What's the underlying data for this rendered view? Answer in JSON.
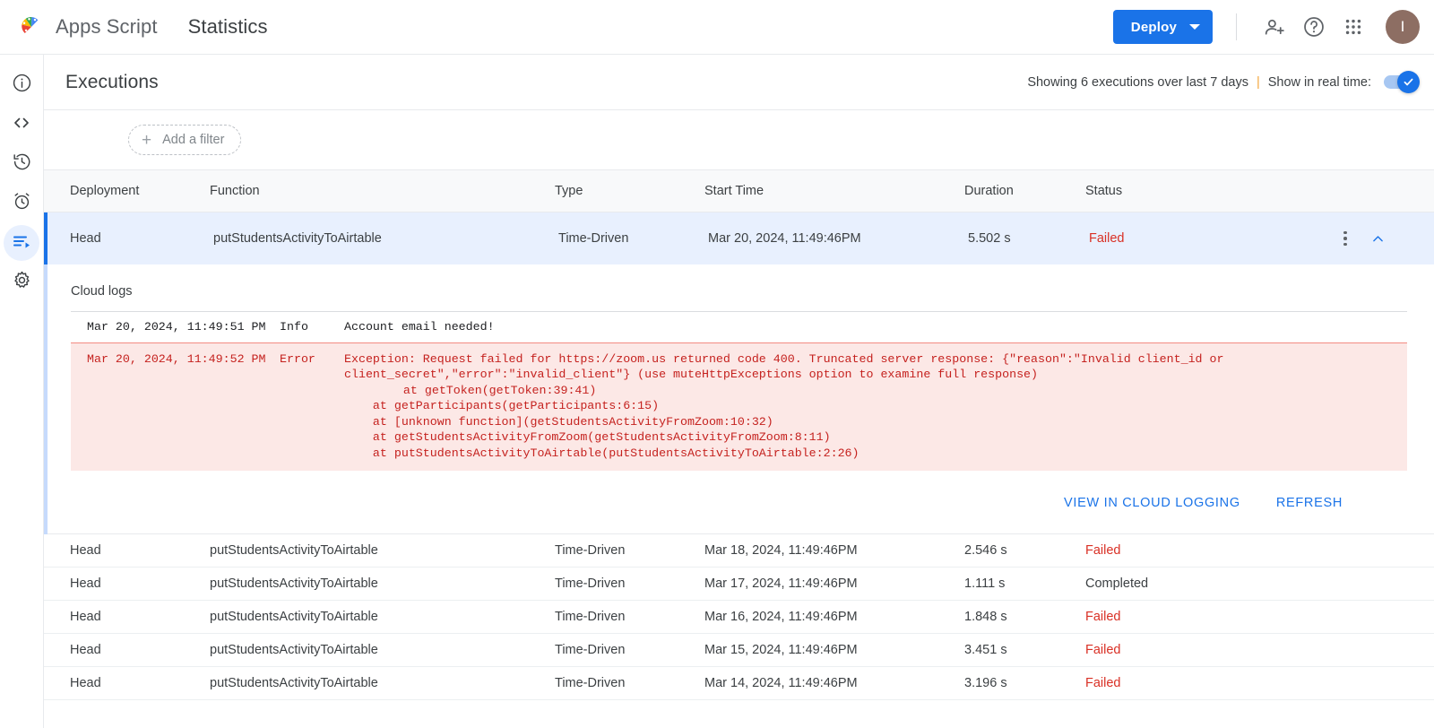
{
  "topbar": {
    "logo_icon": "apps-script-logo",
    "brand": "Apps Script",
    "doc_title": "Statistics",
    "deploy_label": "Deploy",
    "deploy_caret_icon": "chevron-down-icon",
    "add_person_icon": "person-add-icon",
    "help_icon": "help-circle-icon",
    "apps_grid_icon": "apps-grid-icon",
    "avatar_initial": "I",
    "accent_color": "#1a73e8",
    "avatar_color": "#8d6e63"
  },
  "rail": {
    "items": [
      {
        "name": "overview",
        "icon": "info-circle-icon",
        "active": false
      },
      {
        "name": "editor",
        "icon": "code-brackets-icon",
        "active": false
      },
      {
        "name": "versions",
        "icon": "history-clock-icon",
        "active": false
      },
      {
        "name": "triggers",
        "icon": "alarm-clock-icon",
        "active": false
      },
      {
        "name": "executions",
        "icon": "executions-list-icon",
        "active": true
      },
      {
        "name": "project-settings",
        "icon": "gear-icon",
        "active": false
      }
    ]
  },
  "executions": {
    "title": "Executions",
    "showing_text": "Showing 6 executions over last 7 days",
    "separator": "|",
    "realtime_label": "Show in real time:",
    "realtime_on": true,
    "toggle_check_icon": "check-icon",
    "filter_label": "Add a filter",
    "filter_plus_icon": "plus-icon",
    "columns": [
      "Deployment",
      "Function",
      "Type",
      "Start Time",
      "Duration",
      "Status"
    ],
    "rows": [
      {
        "deployment": "Head",
        "function": "putStudentsActivityToAirtable",
        "type": "Time-Driven",
        "start_time": "Mar 20, 2024, 11:49:46PM",
        "duration": "5.502 s",
        "status": "Failed",
        "selected": true,
        "kebab_icon": "more-vert-icon",
        "collapse_icon": "chevron-up-icon"
      },
      {
        "deployment": "Head",
        "function": "putStudentsActivityToAirtable",
        "type": "Time-Driven",
        "start_time": "Mar 18, 2024, 11:49:46PM",
        "duration": "2.546 s",
        "status": "Failed",
        "selected": false
      },
      {
        "deployment": "Head",
        "function": "putStudentsActivityToAirtable",
        "type": "Time-Driven",
        "start_time": "Mar 17, 2024, 11:49:46PM",
        "duration": "1.111 s",
        "status": "Completed",
        "selected": false
      },
      {
        "deployment": "Head",
        "function": "putStudentsActivityToAirtable",
        "type": "Time-Driven",
        "start_time": "Mar 16, 2024, 11:49:46PM",
        "duration": "1.848 s",
        "status": "Failed",
        "selected": false
      },
      {
        "deployment": "Head",
        "function": "putStudentsActivityToAirtable",
        "type": "Time-Driven",
        "start_time": "Mar 15, 2024, 11:49:46PM",
        "duration": "3.451 s",
        "status": "Failed",
        "selected": false
      },
      {
        "deployment": "Head",
        "function": "putStudentsActivityToAirtable",
        "type": "Time-Driven",
        "start_time": "Mar 14, 2024, 11:49:46PM",
        "duration": "3.196 s",
        "status": "Failed",
        "selected": false
      }
    ]
  },
  "detail": {
    "cloud_logs_label": "Cloud logs",
    "info_log": {
      "timestamp": "Mar 20, 2024, 11:49:51 PM",
      "level": "Info",
      "message": "Account email needed!"
    },
    "error_log": {
      "timestamp": "Mar 20, 2024, 11:49:52 PM",
      "level": "Error",
      "message": "Exception: Request failed for https://zoom.us returned code 400. Truncated server response: {\"reason\":\"Invalid client_id or\nclient_secret\",\"error\":\"invalid_client\"} (use muteHttpExceptions option to examine full response)",
      "stack": "    at getToken(getToken:39:41)\n    at getParticipants(getParticipants:6:15)\n    at [unknown function](getStudentsActivityFromZoom:10:32)\n    at getStudentsActivityFromZoom(getStudentsActivityFromZoom:8:11)\n    at putStudentsActivityToAirtable(putStudentsActivityToAirtable:2:26)"
    },
    "view_logging_label": "View in Cloud Logging",
    "refresh_label": "Refresh",
    "error_bg_color": "#fce8e6",
    "error_text_color": "#c5221f"
  }
}
